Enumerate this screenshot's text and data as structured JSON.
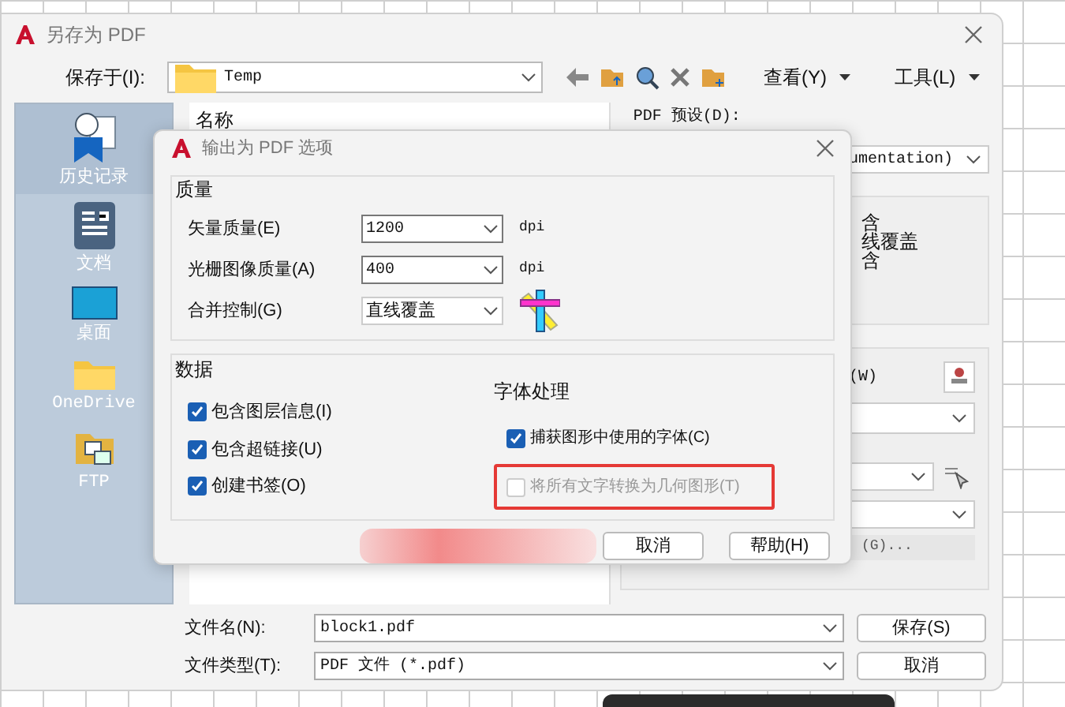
{
  "save_dialog": {
    "title": "另存为 PDF",
    "save_in": {
      "label": "保存于(I):",
      "value": "Temp"
    },
    "menus": [
      {
        "label": "查看(Y)"
      },
      {
        "label": "工具(L)"
      }
    ],
    "places": [
      {
        "label": "历史记录",
        "kind": "history",
        "selected": true
      },
      {
        "label": "文档",
        "kind": "documents",
        "selected": false
      },
      {
        "label": "桌面",
        "kind": "desktop",
        "selected": false
      },
      {
        "label": "OneDrive",
        "kind": "folder",
        "selected": false
      },
      {
        "label": "FTP",
        "kind": "ftp",
        "selected": false
      }
    ],
    "file_list": {
      "column": "名称"
    },
    "preset": {
      "label": "PDF 预设(D):",
      "value": "umentation)"
    },
    "summary_lines": [
      "含",
      "线覆盖",
      "含"
    ],
    "section_label": "(W)",
    "side_button": "(G)...",
    "file_name": {
      "label": "文件名(N):",
      "value": "block1.pdf"
    },
    "file_type": {
      "label": "文件类型(T):",
      "value": "PDF 文件 (*.pdf)"
    },
    "buttons": [
      "保存(S)",
      "取消"
    ]
  },
  "options_dialog": {
    "title": "输出为 PDF 选项",
    "quality": {
      "title": "质量",
      "rows": [
        {
          "label": "矢量质量(E)",
          "value": "1200",
          "unit": "dpi"
        },
        {
          "label": "光栅图像质量(A)",
          "value": "400",
          "unit": "dpi"
        },
        {
          "label": "合并控制(G)",
          "value": "直线覆盖"
        }
      ]
    },
    "data": {
      "title": "数据",
      "options": [
        {
          "label": "包含图层信息(I)",
          "checked": true
        },
        {
          "label": "包含超链接(U)",
          "checked": true
        },
        {
          "label": "创建书签(O)",
          "checked": true
        }
      ]
    },
    "fonts": {
      "title": "字体处理",
      "options": [
        {
          "label": "捕获图形中使用的字体(C)",
          "checked": true,
          "disabled": false,
          "highlighted": false
        },
        {
          "label": "将所有文字转换为几何图形(T)",
          "checked": false,
          "disabled": true,
          "highlighted": true
        }
      ]
    },
    "buttons": [
      "取消",
      "帮助(H)"
    ]
  }
}
